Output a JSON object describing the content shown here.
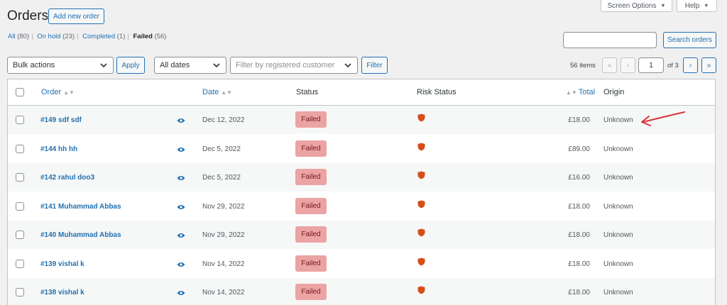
{
  "header": {
    "title": "Orders",
    "add_new_label": "Add new order",
    "screen_options_label": "Screen Options",
    "help_label": "Help"
  },
  "views": [
    {
      "label": "All",
      "count": "(80)"
    },
    {
      "label": "On hold",
      "count": "(23)"
    },
    {
      "label": "Completed",
      "count": "(1)"
    },
    {
      "label": "Failed",
      "count": "(56)",
      "current": true
    }
  ],
  "search": {
    "value": "",
    "button_label": "Search orders"
  },
  "filters": {
    "bulk_actions": "Bulk actions",
    "apply_label": "Apply",
    "dates": "All dates",
    "customer_placeholder": "Filter by registered customer",
    "filter_label": "Filter"
  },
  "pagination": {
    "items_text": "56 items",
    "first": "«",
    "prev": "‹",
    "current_page": "1",
    "of_text": "of 3",
    "next": "›",
    "last": "»"
  },
  "table": {
    "columns": {
      "order": "Order",
      "date": "Date",
      "status": "Status",
      "risk": "Risk Status",
      "total": "Total",
      "origin": "Origin"
    },
    "rows": [
      {
        "order": "#149 sdf sdf",
        "date": "Dec 12, 2022",
        "status": "Failed",
        "total": "£18.00",
        "origin": "Unknown"
      },
      {
        "order": "#144 hh hh",
        "date": "Dec 5, 2022",
        "status": "Failed",
        "total": "£89.00",
        "origin": "Unknown"
      },
      {
        "order": "#142 rahul doo3",
        "date": "Dec 5, 2022",
        "status": "Failed",
        "total": "£16.00",
        "origin": "Unknown"
      },
      {
        "order": "#141 Muhammad Abbas",
        "date": "Nov 29, 2022",
        "status": "Failed",
        "total": "£18.00",
        "origin": "Unknown"
      },
      {
        "order": "#140 Muhammad Abbas",
        "date": "Nov 29, 2022",
        "status": "Failed",
        "total": "£18.00",
        "origin": "Unknown"
      },
      {
        "order": "#139 vishal k",
        "date": "Nov 14, 2022",
        "status": "Failed",
        "total": "£18.00",
        "origin": "Unknown"
      },
      {
        "order": "#138 vishal k",
        "date": "Nov 14, 2022",
        "status": "Failed",
        "total": "£18.00",
        "origin": "Unknown"
      }
    ]
  },
  "colors": {
    "accent": "#2271b1",
    "failed_badge_bg": "#eba3a3",
    "failed_badge_text": "#761919",
    "risk_shield": "#d64e1b",
    "arrow": "#d63638"
  },
  "icons": {
    "risk": "shield-icon",
    "preview": "eye-icon",
    "annotation": "red-arrow"
  }
}
